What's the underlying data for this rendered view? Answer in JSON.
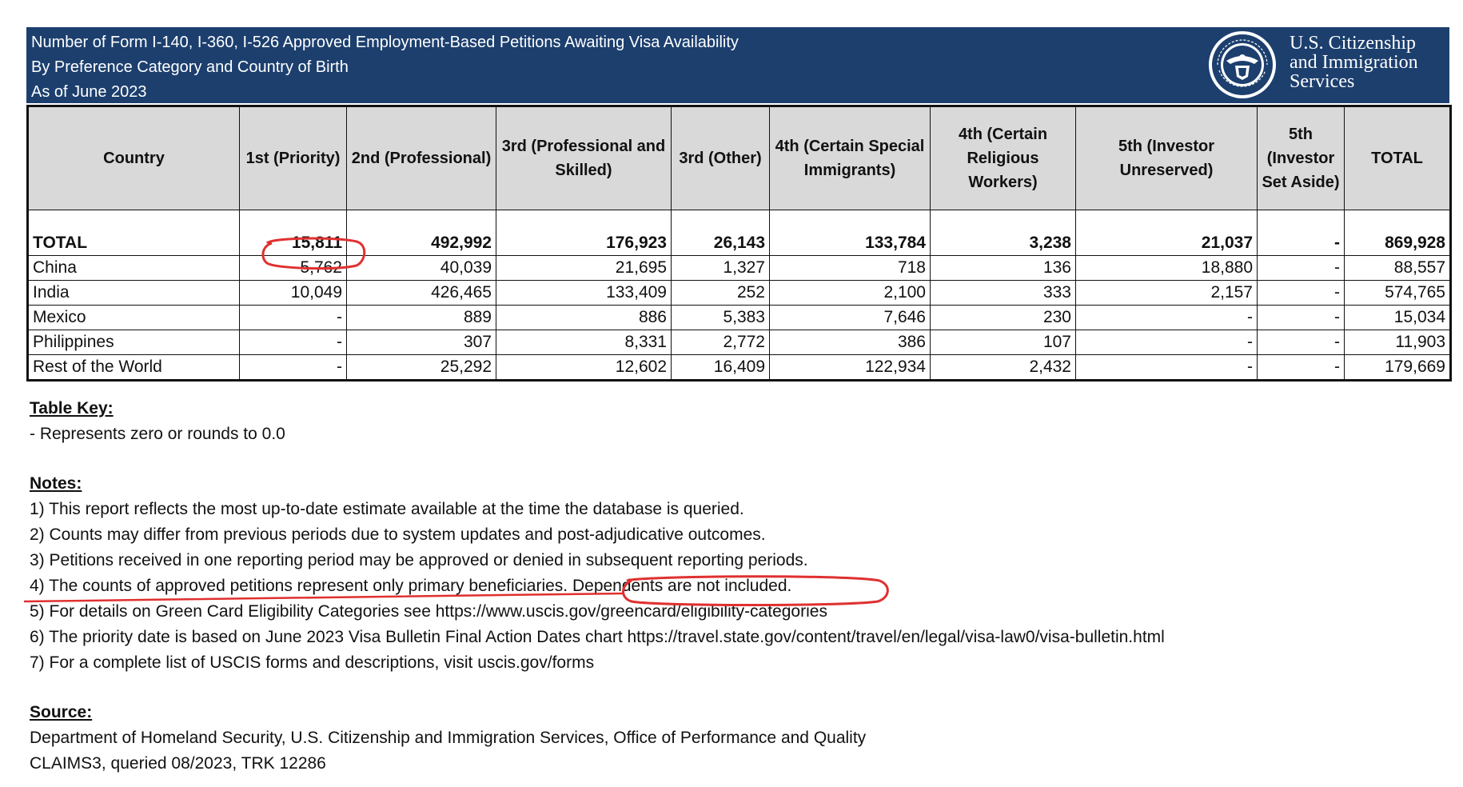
{
  "header": {
    "title_line1": "Number of Form I-140, I-360, I-526 Approved Employment-Based Petitions Awaiting Visa Availability",
    "title_line2": "By Preference Category and Country of Birth",
    "title_line3": "As of June 2023",
    "agency_line1": "U.S. Citizenship",
    "agency_line2": "and Immigration",
    "agency_line3": "Services",
    "seal_icon": "dhs-seal-icon",
    "banner_color": "#1c3f6e"
  },
  "table": {
    "columns": [
      "Country",
      "1st (Priority)",
      "2nd (Professional)",
      "3rd (Professional and Skilled)",
      "3rd (Other)",
      "4th (Certain Special Immigrants)",
      "4th (Certain Religious Workers)",
      "5th (Investor Unreserved)",
      "5th (Investor Set Aside)",
      "TOTAL"
    ],
    "rows": [
      [
        "TOTAL",
        "15,811",
        "492,992",
        "176,923",
        "26,143",
        "133,784",
        "3,238",
        "21,037",
        "-",
        "869,928"
      ],
      [
        "China",
        "5,762",
        "40,039",
        "21,695",
        "1,327",
        "718",
        "136",
        "18,880",
        "-",
        "88,557"
      ],
      [
        "India",
        "10,049",
        "426,465",
        "133,409",
        "252",
        "2,100",
        "333",
        "2,157",
        "-",
        "574,765"
      ],
      [
        "Mexico",
        "-",
        "889",
        "886",
        "5,383",
        "7,646",
        "230",
        "-",
        "-",
        "15,034"
      ],
      [
        "Philippines",
        "-",
        "307",
        "8,331",
        "2,772",
        "386",
        "107",
        "-",
        "-",
        "11,903"
      ],
      [
        "Rest of the World",
        "-",
        "25,292",
        "12,602",
        "16,409",
        "122,934",
        "2,432",
        "-",
        "-",
        "179,669"
      ]
    ]
  },
  "key": {
    "heading": "Table Key:",
    "line1": "- Represents zero or rounds to 0.0"
  },
  "notes": {
    "heading": "Notes:",
    "items": [
      "1) This report reflects the most up-to-date estimate available at the time the database is queried.",
      "2) Counts may differ from previous periods due to system updates and post-adjudicative outcomes.",
      "3) Petitions received in one reporting period may be approved or denied in subsequent reporting periods.",
      "4) The counts of approved petitions represent only primary beneficiaries. Dependents are not included.",
      "5) For details on Green Card Eligibility Categories see https://www.uscis.gov/greencard/eligibility-categories",
      "6) The priority date is based on June 2023 Visa Bulletin Final Action Dates chart https://travel.state.gov/content/travel/en/legal/visa-law0/visa-bulletin.html",
      "7) For a complete list of USCIS forms and descriptions, visit uscis.gov/forms"
    ]
  },
  "source": {
    "heading": "Source:",
    "line1": "Department of Homeland Security, U.S. Citizenship and Immigration Services, Office of Performance and Quality",
    "line2": "CLAIMS3, queried 08/2023, TRK 12286"
  },
  "annotation_color": "#e03030"
}
